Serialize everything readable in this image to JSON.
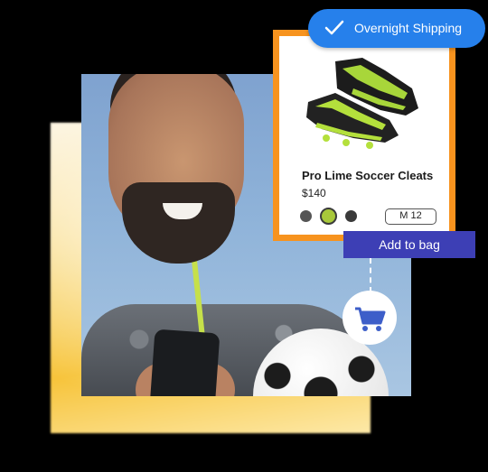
{
  "shipping_badge": {
    "label": "Overnight Shipping",
    "icon": "checkmark-icon",
    "color": "#2680eb"
  },
  "product": {
    "name": "Pro Lime Soccer Cleats",
    "price": "$140",
    "colors": [
      {
        "name": "gray",
        "hex": "#555555",
        "selected": false
      },
      {
        "name": "lime",
        "hex": "#a8c83a",
        "selected": true
      },
      {
        "name": "dark",
        "hex": "#3a3a3a",
        "selected": false
      }
    ],
    "size": "M 12",
    "accent": "#f7931e"
  },
  "cta": {
    "add_to_bag_label": "Add to bag",
    "color": "#3d3fb5"
  },
  "cart": {
    "icon": "shopping-cart-icon",
    "color": "#3d5ec9"
  }
}
